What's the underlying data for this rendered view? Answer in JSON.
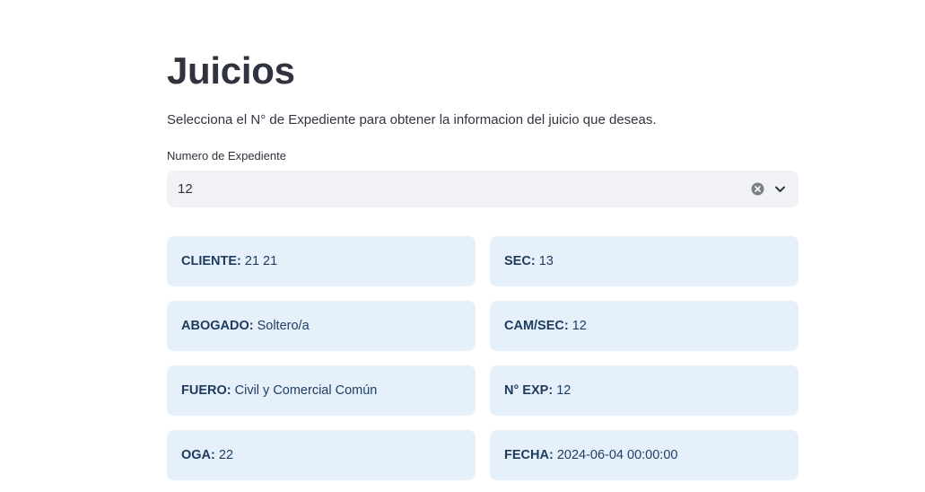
{
  "page": {
    "title": "Juicios",
    "subtitle": "Selecciona el N° de Expediente para obtener la informacion del juicio que deseas."
  },
  "selector": {
    "label": "Numero de Expediente",
    "value": "12",
    "clear_icon": "clear-circle-icon",
    "dropdown_icon": "chevron-down-icon"
  },
  "details": {
    "cliente": {
      "key": "CLIENTE:",
      "value": "21 21"
    },
    "sec": {
      "key": "SEC:",
      "value": "13"
    },
    "abogado": {
      "key": "ABOGADO:",
      "value": "Soltero/a"
    },
    "cam_sec": {
      "key": "CAM/SEC:",
      "value": "12"
    },
    "fuero": {
      "key": "FUERO:",
      "value": "Civil y Comercial Común"
    },
    "n_exp": {
      "key": "N° EXP:",
      "value": "12"
    },
    "oga": {
      "key": "OGA:",
      "value": "22"
    },
    "fecha": {
      "key": "FECHA:",
      "value": "2024-06-04 00:00:00"
    }
  },
  "colors": {
    "text": "#31333f",
    "select_bg": "#f0f2f6",
    "card_bg": "#e6f0fb",
    "card_text": "#1e3e63"
  }
}
